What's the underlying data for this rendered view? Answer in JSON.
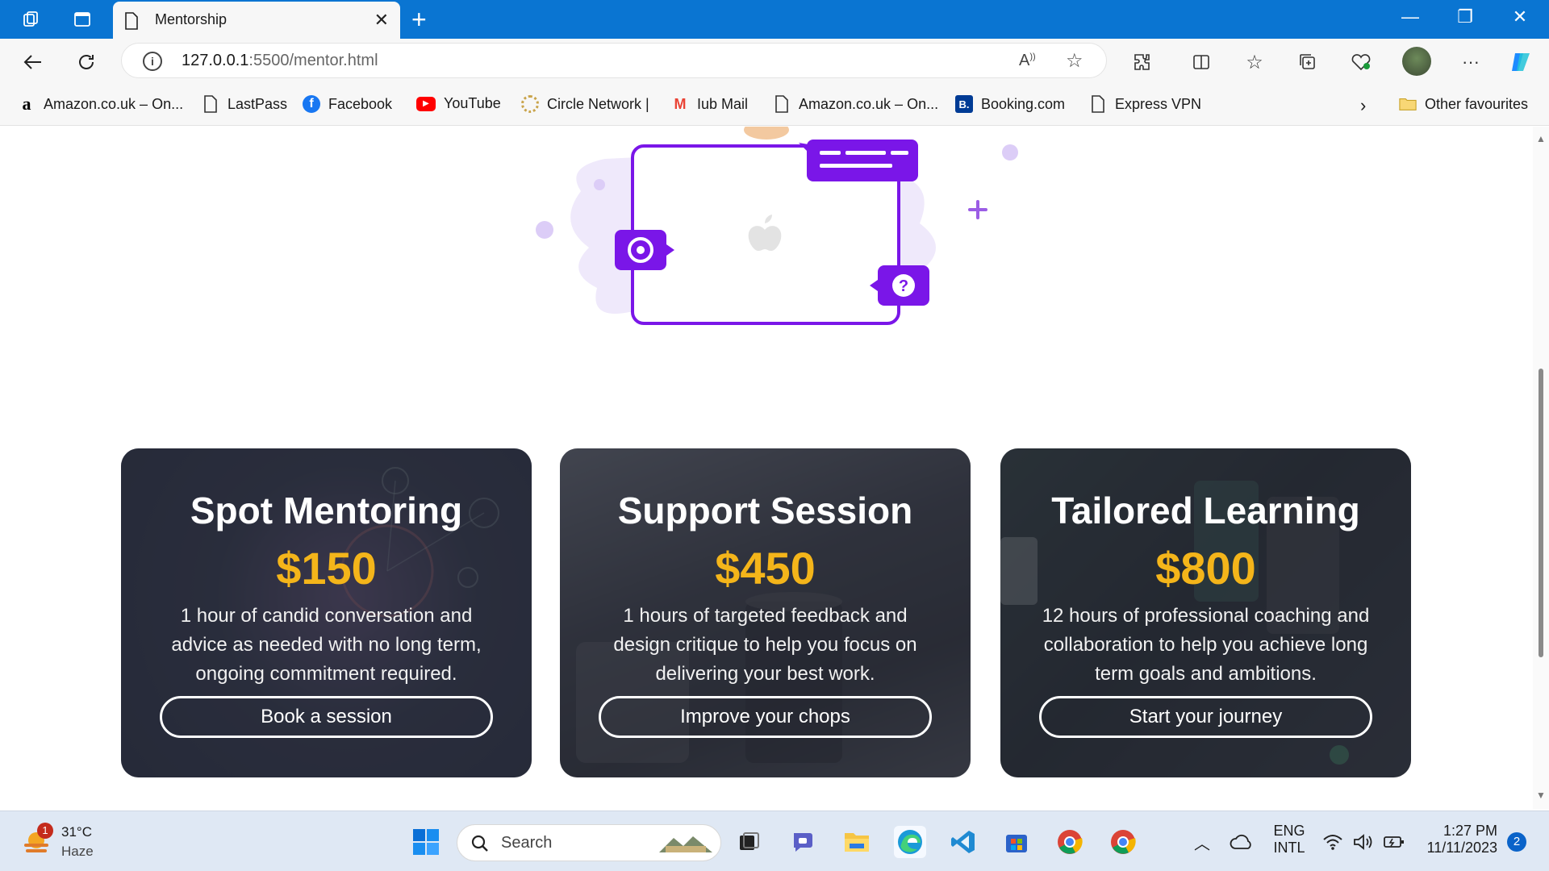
{
  "browser": {
    "tab_title": "Mentorship",
    "url_host": "127.0.0.1",
    "url_path": ":5500/mentor.html"
  },
  "favourites": [
    {
      "label": "Amazon.co.uk – On...",
      "icon": "amazon-icon"
    },
    {
      "label": "LastPass",
      "icon": "page-icon"
    },
    {
      "label": "Facebook",
      "icon": "facebook-icon"
    },
    {
      "label": "YouTube",
      "icon": "youtube-icon"
    },
    {
      "label": "Circle Network |",
      "icon": "circle-network-icon"
    },
    {
      "label": "Iub Mail",
      "icon": "gmail-icon"
    },
    {
      "label": "Amazon.co.uk – On...",
      "icon": "page-icon"
    },
    {
      "label": "Booking.com",
      "icon": "booking-icon"
    },
    {
      "label": "Express VPN",
      "icon": "page-icon"
    }
  ],
  "other_favourites": "Other favourites",
  "cards": [
    {
      "title": "Spot Mentoring",
      "price": "$150",
      "description": "1 hour of candid conversation and advice as needed with no long term, ongoing commitment required.",
      "button": "Book a session"
    },
    {
      "title": "Support Session",
      "price": "$450",
      "description": "1 hours of targeted feedback and design critique to help you focus on delivering your best work.",
      "button": "Improve your chops"
    },
    {
      "title": "Tailored Learning",
      "price": "$800",
      "description": "12 hours of professional coaching and collaboration to help you achieve long term goals and ambitions.",
      "button": "Start your journey"
    }
  ],
  "taskbar": {
    "weather_temp": "31°C",
    "weather_desc": "Haze",
    "weather_badge": "1",
    "search_label": "Search",
    "lang_top": "ENG",
    "lang_bottom": "INTL",
    "time": "1:27 PM",
    "date": "11/11/2023",
    "notif_count": "2"
  },
  "colors": {
    "titlebar": "#0a75d2",
    "accent_purple": "#7a16e8",
    "price_gold": "#f4b51a"
  }
}
